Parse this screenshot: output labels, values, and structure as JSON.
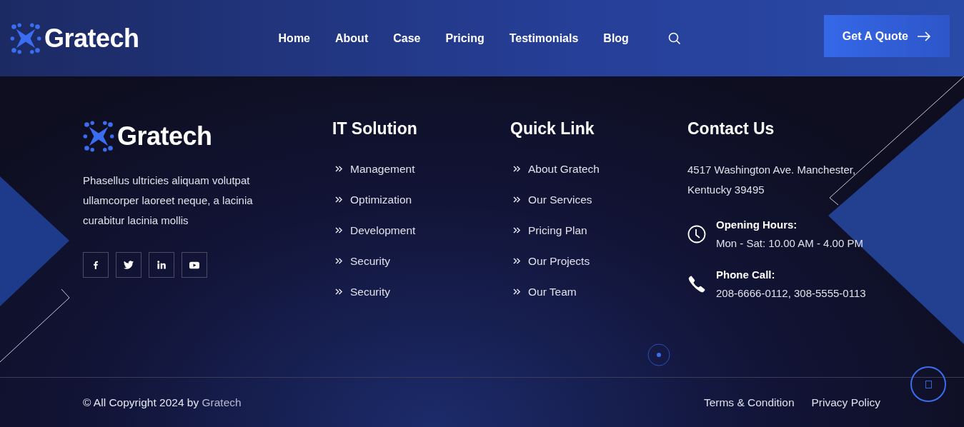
{
  "header": {
    "logo": "Gratech",
    "nav": [
      "Home",
      "About",
      "Case",
      "Pricing",
      "Testimonials",
      "Blog"
    ],
    "cta": "Get A Quote"
  },
  "footer": {
    "brand": {
      "logo": "Gratech",
      "description": "Phasellus ultricies aliquam volutpat ullamcorper laoreet neque, a lacinia curabitur lacinia mollis",
      "social": [
        {
          "kind": "facebook"
        },
        {
          "kind": "twitter"
        },
        {
          "kind": "linkedin"
        },
        {
          "kind": "youtube"
        }
      ]
    },
    "columns": [
      {
        "title": "IT Solution",
        "links": [
          "Management",
          "Optimization",
          "Development",
          "Security",
          "Security"
        ]
      },
      {
        "title": "Quick Link",
        "links": [
          "About Gratech",
          "Our Services",
          "Pricing Plan",
          "Our Projects",
          "Our Team"
        ]
      }
    ],
    "contact": {
      "title": "Contact Us",
      "address": "4517 Washington Ave. Manchester, Kentucky 39495",
      "items": [
        {
          "kind": "clock",
          "label": "Opening Hours:",
          "value": "Mon - Sat: 10.00 AM - 4.00 PM"
        },
        {
          "kind": "phone",
          "label": "Phone Call:",
          "value": "208-6666-0112, 308-5555-0113"
        }
      ]
    }
  },
  "bottom_bar": {
    "copyright": "© All Copyright 2024 by ",
    "copyright_link": "Gratech",
    "links": [
      "Terms & Condition",
      "Privacy Policy"
    ]
  }
}
